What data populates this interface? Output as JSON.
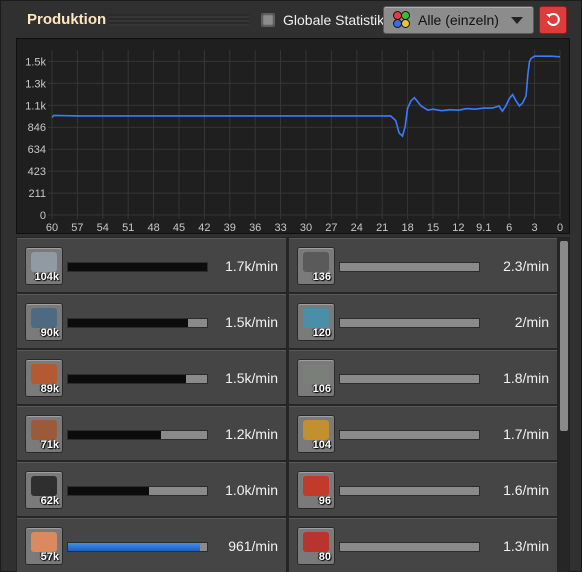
{
  "header": {
    "title": "Produktion",
    "global_stats_label": "Globale Statistik",
    "global_stats_checked": false,
    "filter_selected": "Alle (einzeln)"
  },
  "chart_data": {
    "type": "line",
    "y_ticks": [
      "1.5k",
      "1.3k",
      "1.1k",
      "846",
      "634",
      "423",
      "211",
      "0"
    ],
    "x_ticks": [
      "60",
      "57",
      "54",
      "51",
      "48",
      "45",
      "42",
      "39",
      "36",
      "33",
      "30",
      "27",
      "24",
      "21",
      "18",
      "15",
      "12",
      "9.1",
      "6",
      "3",
      "0"
    ],
    "ylim": [
      0,
      1590
    ],
    "xlim": [
      60,
      0
    ],
    "grid": true,
    "line_color": "#3a7cff",
    "series": [
      {
        "x": [
          60,
          59.8,
          57,
          50,
          40,
          30,
          21,
          20,
          19.4,
          19,
          18.6,
          18.3,
          18,
          17.6,
          17.2,
          16.8,
          16.4,
          16,
          15.6,
          15,
          14,
          13,
          12,
          11,
          10,
          9,
          8,
          7.2,
          6.8,
          6.4,
          6,
          5.6,
          5.2,
          4.8,
          4.4,
          4,
          3.8,
          3.6,
          3.4,
          3,
          2,
          1,
          0.2,
          0
        ],
        "y": [
          940,
          960,
          955,
          955,
          955,
          955,
          955,
          955,
          910,
          790,
          760,
          850,
          1030,
          1100,
          1130,
          1090,
          1050,
          1030,
          1010,
          1020,
          1005,
          1015,
          1010,
          1025,
          1020,
          1030,
          1030,
          1050,
          1000,
          1050,
          1120,
          1160,
          1100,
          1050,
          1080,
          1150,
          1350,
          1480,
          1510,
          1530,
          1530,
          1530,
          1525,
          1525
        ]
      }
    ]
  },
  "items": [
    {
      "count": "104k",
      "rate": "1.7k/min",
      "fill": 1.0,
      "icon": "iron-plate-icon",
      "icon_color": "#8f9aa3",
      "bar": "dark"
    },
    {
      "count": "136",
      "rate": "2.3/min",
      "fill": 0.0,
      "icon": "iron-stick-icon",
      "icon_color": "#5a5a5a",
      "bar": "dark"
    },
    {
      "count": "90k",
      "rate": "1.5k/min",
      "fill": 0.86,
      "icon": "iron-ore-icon",
      "icon_color": "#4d6a82",
      "bar": "dark"
    },
    {
      "count": "120",
      "rate": "2/min",
      "fill": 0.0,
      "icon": "pipe-icon",
      "icon_color": "#4a8fa8",
      "bar": "dark"
    },
    {
      "count": "89k",
      "rate": "1.5k/min",
      "fill": 0.85,
      "icon": "copper-cable-icon",
      "icon_color": "#b45a32",
      "bar": "dark"
    },
    {
      "count": "106",
      "rate": "1.8/min",
      "fill": 0.0,
      "icon": "steel-plate-icon",
      "icon_color": "#7b7f7a",
      "bar": "dark"
    },
    {
      "count": "71k",
      "rate": "1.2k/min",
      "fill": 0.67,
      "icon": "copper-ore-icon",
      "icon_color": "#9b5a3a",
      "bar": "dark"
    },
    {
      "count": "104",
      "rate": "1.7/min",
      "fill": 0.0,
      "icon": "inserter-icon",
      "icon_color": "#c2902e",
      "bar": "dark"
    },
    {
      "count": "62k",
      "rate": "1.0k/min",
      "fill": 0.58,
      "icon": "coal-icon",
      "icon_color": "#2f2f2f",
      "bar": "dark"
    },
    {
      "count": "96",
      "rate": "1.6/min",
      "fill": 0.0,
      "icon": "red-circuit-icon",
      "icon_color": "#c23a2a",
      "bar": "dark"
    },
    {
      "count": "57k",
      "rate": "961/min",
      "fill": 0.95,
      "icon": "copper-plate-icon",
      "icon_color": "#d98a5f",
      "bar": "blue"
    },
    {
      "count": "80",
      "rate": "1.3/min",
      "fill": 0.0,
      "icon": "red-science-icon",
      "icon_color": "#b8342c",
      "bar": "dark"
    }
  ]
}
